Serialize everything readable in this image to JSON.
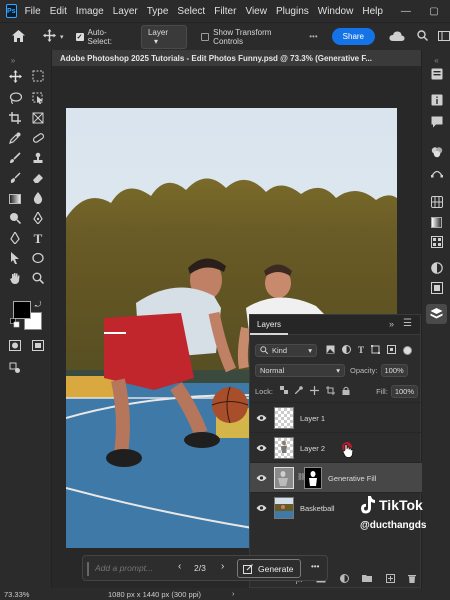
{
  "menubar": {
    "app_logo": "Ps",
    "items": [
      "File",
      "Edit",
      "Image",
      "Layer",
      "Type",
      "Select",
      "Filter",
      "View",
      "Plugins",
      "Window",
      "Help"
    ],
    "window_controls": [
      "—",
      "▢",
      "✕"
    ]
  },
  "optionsbar": {
    "auto_select_label": "Auto-Select:",
    "auto_select_target": "Layer",
    "transform_controls_label": "Show Transform Controls",
    "share_label": "Share"
  },
  "document": {
    "tab_title": "Adobe Photoshop 2025 Tutorials - Edit Photos Funny.psd @ 73.3% (Generative F..."
  },
  "layers_panel": {
    "title": "Layers",
    "filter_kind": "Kind",
    "blend_mode": "Normal",
    "opacity_label": "Opacity:",
    "opacity_value": "100%",
    "lock_label": "Lock:",
    "fill_label": "Fill:",
    "fill_value": "100%",
    "layers": [
      {
        "name": "Layer 1",
        "visible": true
      },
      {
        "name": "Layer 2",
        "visible": true
      },
      {
        "name": "Generative Fill",
        "visible": true,
        "selected": true
      },
      {
        "name": "Basketball",
        "visible": true
      }
    ]
  },
  "generate_bar": {
    "placeholder": "Add a prompt...",
    "variation": "2/3",
    "generate_label": "Generate",
    "more": "•••"
  },
  "statusbar": {
    "zoom": "73.33%",
    "doc_info": "1080 px x 1440 px (300 ppi)"
  },
  "watermark": {
    "brand": "TikTok",
    "handle": "@ducthangds"
  },
  "colors": {
    "ui_bg": "#2b2b2b",
    "accent": "#1473e6",
    "canvas_bg": "#282828"
  }
}
